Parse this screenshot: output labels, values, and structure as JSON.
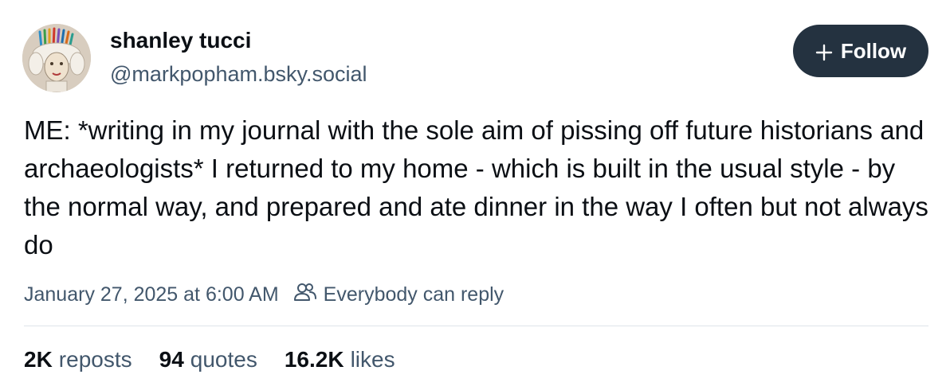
{
  "author": {
    "display_name": "shanley tucci",
    "handle": "@markpopham.bsky.social",
    "avatar_icon": "avatar-illustration"
  },
  "follow_button": {
    "label": "Follow",
    "icon": "plus-icon",
    "background": "#243240",
    "text_color": "#ffffff"
  },
  "post": {
    "text": "ME: *writing in my journal with the sole aim of pissing off future historians and archaeologists* I returned to my home - which is built in the usual style - by the normal way, and prepared and ate dinner in the way I often but not always do",
    "timestamp": "January 27, 2025 at 6:00 AM",
    "reply_setting": "Everybody can reply",
    "reply_setting_icon": "people-icon"
  },
  "stats": {
    "reposts": {
      "count": "2K",
      "label": "reposts"
    },
    "quotes": {
      "count": "94",
      "label": "quotes"
    },
    "likes": {
      "count": "16.2K",
      "label": "likes"
    }
  },
  "colors": {
    "text_primary": "#0b0f14",
    "text_secondary": "#42576c",
    "divider": "#dfe4ea"
  }
}
